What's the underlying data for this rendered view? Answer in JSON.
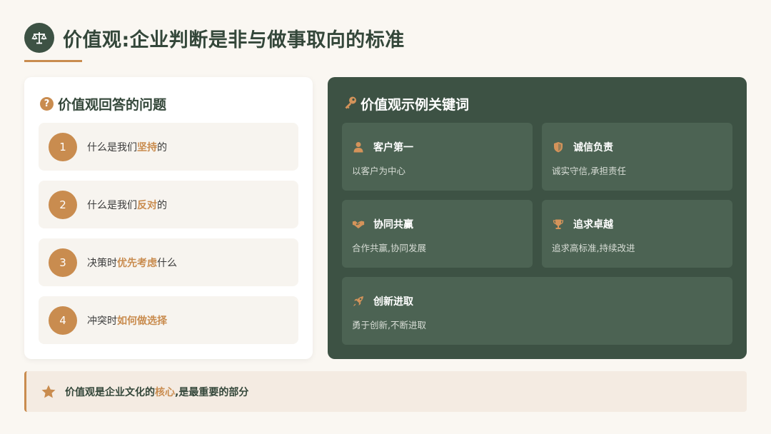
{
  "header": {
    "title": "价值观:企业判断是非与做事取向的标准",
    "icon": "scale-icon"
  },
  "left_card": {
    "heading": "价值观回答的问题",
    "icon": "question-icon",
    "items": [
      {
        "num": "1",
        "pre": "什么是我们",
        "hl": "坚持",
        "post": "的"
      },
      {
        "num": "2",
        "pre": "什么是我们",
        "hl": "反对",
        "post": "的"
      },
      {
        "num": "3",
        "pre": "决策时",
        "hl": "优先考虑",
        "post": "什么"
      },
      {
        "num": "4",
        "pre": "冲突时",
        "hl": "如何做选择",
        "post": ""
      }
    ]
  },
  "right_panel": {
    "heading": "价值观示例关键词",
    "icon": "key-icon",
    "keywords": [
      {
        "icon": "user-icon",
        "title": "客户第一",
        "desc": "以客户为中心"
      },
      {
        "icon": "shield-icon",
        "title": "诚信负责",
        "desc": "诚实守信,承担责任"
      },
      {
        "icon": "handshake-icon",
        "title": "协同共赢",
        "desc": "合作共赢,协同发展"
      },
      {
        "icon": "trophy-icon",
        "title": "追求卓越",
        "desc": "追求高标准,持续改进"
      },
      {
        "icon": "rocket-icon",
        "title": "创新进取",
        "desc": "勇于创新,不断进取"
      }
    ]
  },
  "bottom": {
    "icon": "star-icon",
    "pre": "价值观是企业文化的",
    "hl": "核心",
    "post": ",是最重要的部分"
  },
  "colors": {
    "primary": "#3d5244",
    "accent": "#c98c4f",
    "card_dark": "#4c6353",
    "background": "#faf7f2"
  }
}
